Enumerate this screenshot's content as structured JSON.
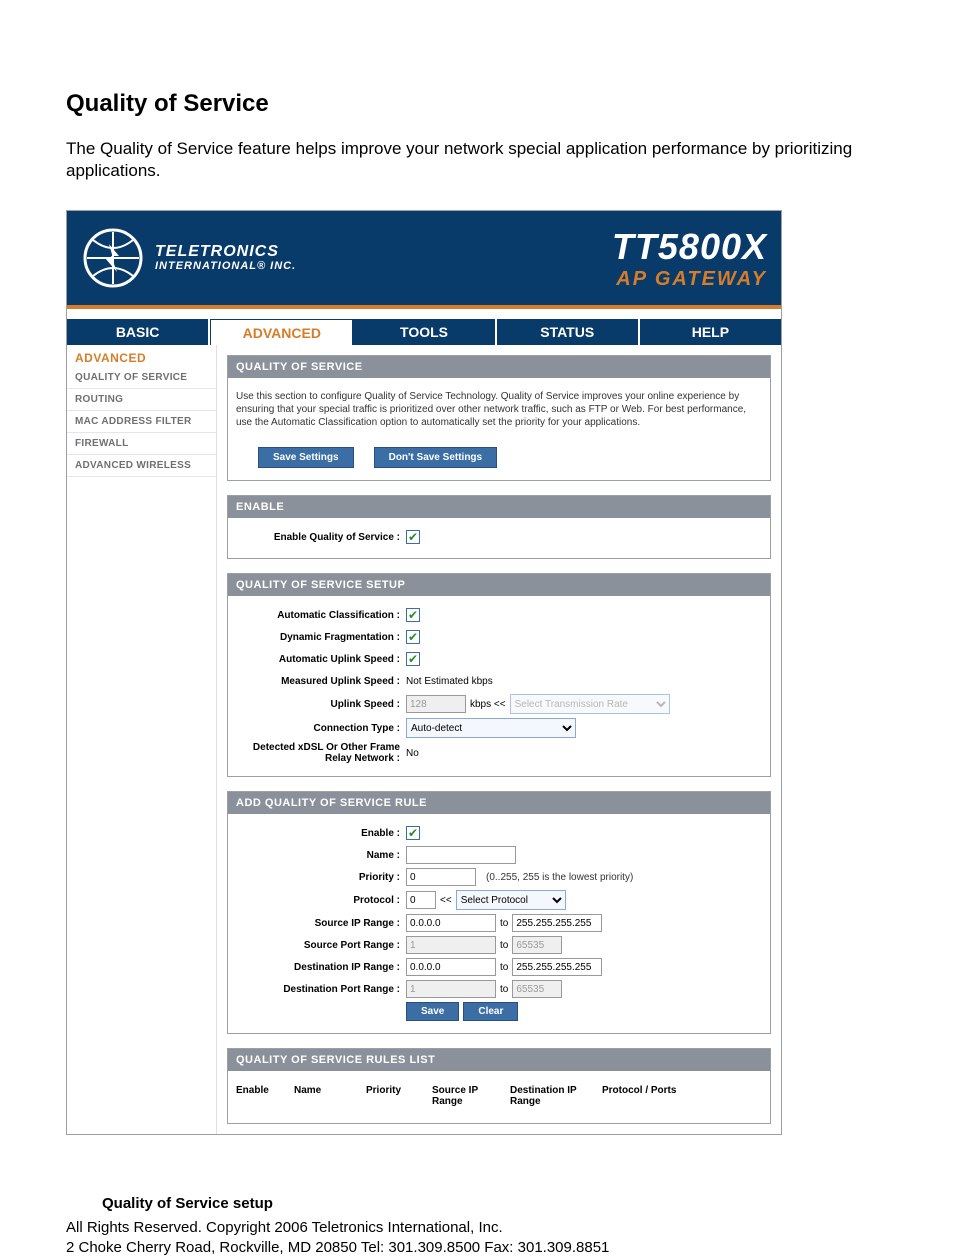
{
  "doc": {
    "title": "Quality of Service",
    "intro": "The Quality of Service feature helps improve your network special application performance by prioritizing applications.",
    "sub_heading": "Quality of Service setup",
    "footer_line1": "All Rights Reserved. Copyright 2006 Teletronics International, Inc.",
    "footer_line2": "2 Choke Cherry Road, Rockville, MD 20850    Tel: 301.309.8500 Fax: 301.309.8851"
  },
  "brand": {
    "company_big": "TELETRONICS",
    "company_small": "INTERNATIONAL® INC.",
    "product_name": "TT5800X",
    "product_tag": "AP GATEWAY"
  },
  "tabs": {
    "basic": "BASIC",
    "advanced": "ADVANCED",
    "tools": "TOOLS",
    "status": "STATUS",
    "help": "HELP"
  },
  "sidebar": {
    "heading": "ADVANCED",
    "items": [
      "QUALITY OF SERVICE",
      "ROUTING",
      "MAC ADDRESS FILTER",
      "FIREWALL",
      "ADVANCED WIRELESS"
    ]
  },
  "qos_panel": {
    "title": "QUALITY OF SERVICE",
    "desc": "Use this section to configure Quality of Service Technology. Quality of Service improves your online experience by ensuring that your special traffic is prioritized over other network traffic, such as FTP or Web. For best performance, use the Automatic Classification option to automatically set the priority for your applications.",
    "save": "Save Settings",
    "dont_save": "Don't Save Settings"
  },
  "enable_panel": {
    "title": "ENABLE",
    "label": "Enable Quality of Service :"
  },
  "setup_panel": {
    "title": "QUALITY OF SERVICE SETUP",
    "auto_class": "Automatic Classification :",
    "dyn_frag": "Dynamic Fragmentation :",
    "auto_uplink": "Automatic Uplink Speed :",
    "measured": "Measured Uplink Speed :",
    "measured_val": "Not Estimated  kbps",
    "uplink": "Uplink Speed :",
    "uplink_val": "128",
    "uplink_unit": "kbps   <<",
    "uplink_select": "Select Transmission Rate",
    "conn_type": "Connection Type :",
    "conn_type_val": "Auto-detect",
    "detected": "Detected xDSL Or Other Frame Relay Network :",
    "detected_val": "No"
  },
  "add_rule": {
    "title": "ADD QUALITY OF SERVICE RULE",
    "enable": "Enable :",
    "name": "Name :",
    "name_val": "",
    "priority": "Priority :",
    "priority_val": "0",
    "priority_hint": "(0..255, 255 is the lowest priority)",
    "protocol": "Protocol  :",
    "protocol_val": "0",
    "protocol_sep": "<<",
    "protocol_select": "Select Protocol",
    "src_ip": "Source IP Range :",
    "src_ip_from": "0.0.0.0",
    "src_ip_to": "255.255.255.255",
    "src_port": "Source Port Range :",
    "src_port_from": "1",
    "src_port_to": "65535",
    "dst_ip": "Destination IP Range :",
    "dst_ip_from": "0.0.0.0",
    "dst_ip_to": "255.255.255.255",
    "dst_port": "Destination Port Range :",
    "dst_port_from": "1",
    "dst_port_to": "65535",
    "to_word": "to",
    "save": "Save",
    "clear": "Clear"
  },
  "rules_list": {
    "title": "QUALITY OF SERVICE RULES LIST",
    "headers": {
      "enable": "Enable",
      "name": "Name",
      "priority": "Priority",
      "src": "Source IP Range",
      "dst": "Destination IP Range",
      "pp": "Protocol / Ports"
    }
  }
}
